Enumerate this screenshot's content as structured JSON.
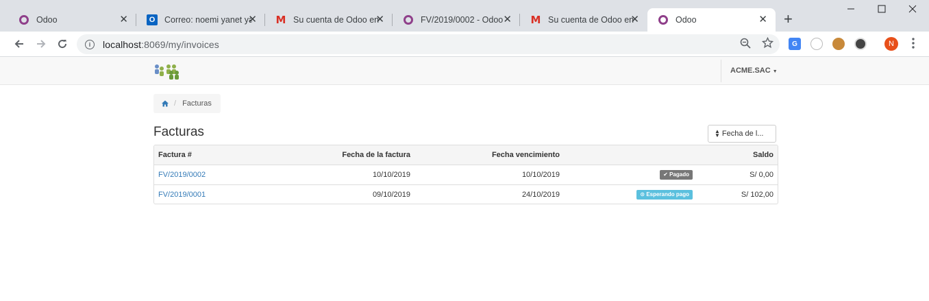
{
  "browser": {
    "tabs": [
      {
        "title": "Odoo",
        "icon": "odoo-icon",
        "active": false
      },
      {
        "title": "Correo: noemi yanet ya",
        "icon": "outlook-icon",
        "active": false
      },
      {
        "title": "Su cuenta de Odoo en",
        "icon": "gmail-icon",
        "active": false
      },
      {
        "title": "FV/2019/0002 - Odoo",
        "icon": "odoo-icon",
        "active": false
      },
      {
        "title": "Su cuenta de Odoo en",
        "icon": "gmail-icon",
        "active": false
      },
      {
        "title": "Odoo",
        "icon": "odoo-icon",
        "active": true
      }
    ],
    "url_host": "localhost",
    "url_rest": ":8069/my/invoices",
    "profile_initial": "N",
    "outlook_letter": "O"
  },
  "odoo": {
    "company": "ACME.SAC"
  },
  "breadcrumb": {
    "current": "Facturas"
  },
  "page": {
    "title": "Facturas",
    "sort_label": "Fecha de l..."
  },
  "table": {
    "headers": {
      "invoice": "Factura #",
      "date": "Fecha de la factura",
      "due": "Fecha vencimiento",
      "balance": "Saldo"
    },
    "rows": [
      {
        "invoice": "FV/2019/0002",
        "date": "10/10/2019",
        "due": "10/10/2019",
        "status": "Pagado",
        "status_icon": "check-icon",
        "balance": "S/ 0,00"
      },
      {
        "invoice": "FV/2019/0001",
        "date": "09/10/2019",
        "due": "24/10/2019",
        "status": "Esperando pago",
        "status_icon": "clock-icon",
        "balance": "S/ 102,00"
      }
    ]
  },
  "colors": {
    "odoo_purple": "#8f3f8a",
    "link_blue": "#337ab7",
    "badge_paid": "#777777",
    "badge_waiting": "#5bc0de",
    "profile_orange": "#e8501a"
  }
}
